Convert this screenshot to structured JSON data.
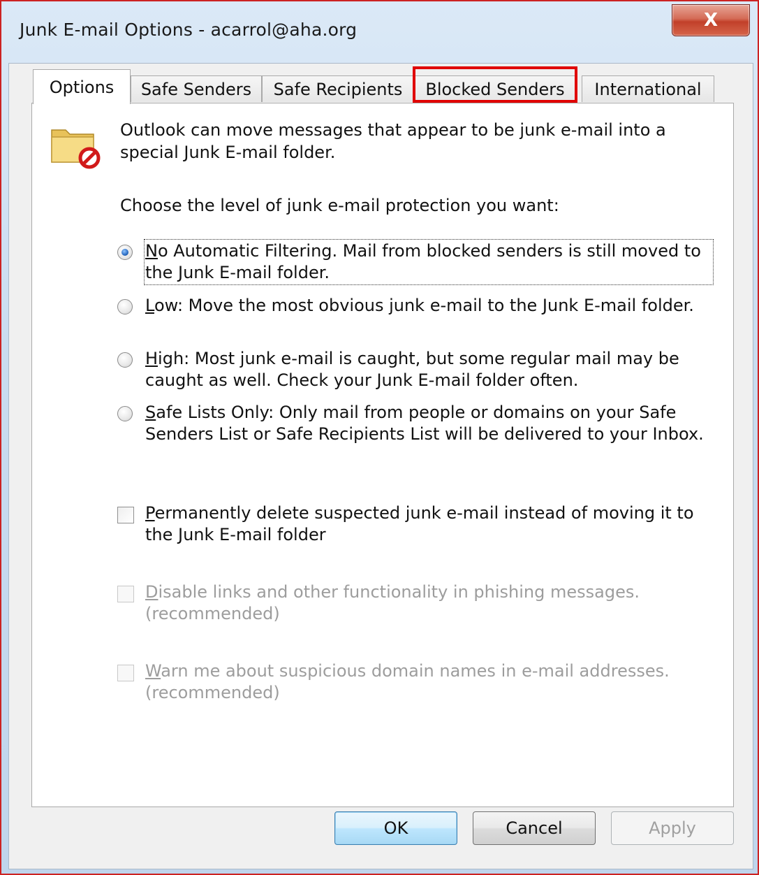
{
  "window": {
    "title": "Junk E-mail Options - acarrol@aha.org",
    "close_glyph": "X"
  },
  "tabs": [
    {
      "label": "Options",
      "active": true
    },
    {
      "label": "Safe Senders",
      "active": false
    },
    {
      "label": "Safe Recipients",
      "active": false
    },
    {
      "label": "Blocked Senders",
      "active": false,
      "highlighted": true
    },
    {
      "label": "International",
      "active": false
    }
  ],
  "options": {
    "intro": "Outlook can move messages that appear to be junk e-mail into a special Junk E-mail folder.",
    "choose_level": "Choose the level of junk e-mail protection you want:",
    "levels": [
      {
        "label": "No Automatic Filtering. Mail from blocked senders is still moved to the Junk E-mail folder.",
        "selected": true
      },
      {
        "label": "Low: Move the most obvious junk e-mail to the Junk E-mail folder.",
        "selected": false
      },
      {
        "label": "High: Most junk e-mail is caught, but some regular mail may be caught as well. Check your Junk E-mail folder often.",
        "selected": false
      },
      {
        "label": "Safe Lists Only: Only mail from people or domains on your Safe Senders List or Safe Recipients List will be delivered to your Inbox.",
        "selected": false
      }
    ],
    "permanently_delete": {
      "label": "Permanently delete suspected junk e-mail instead of moving it to the Junk E-mail folder",
      "checked": false,
      "enabled": true
    },
    "disable_links": {
      "label": "Disable links and other functionality in phishing messages. (recommended)",
      "checked": false,
      "enabled": false
    },
    "warn_domains": {
      "label": "Warn me about suspicious domain names in e-mail addresses. (recommended)",
      "checked": false,
      "enabled": false
    }
  },
  "buttons": {
    "ok": "OK",
    "cancel": "Cancel",
    "apply": "Apply"
  },
  "icons": {
    "intro_icon": "junk-folder-blocked-icon"
  },
  "colors": {
    "highlight_box": "#e00000",
    "close_button": "#c2402a"
  }
}
